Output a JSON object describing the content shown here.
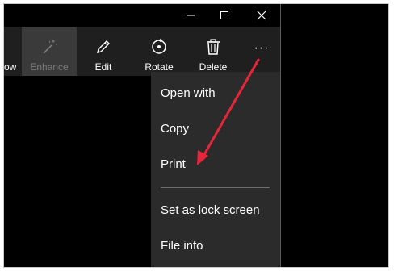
{
  "window_controls": {
    "minimize_icon": "minimize-icon",
    "maximize_icon": "maximize-icon",
    "close_icon": "close-icon"
  },
  "toolbar": {
    "partial_label": "ow",
    "enhance_label": "Enhance",
    "edit_label": "Edit",
    "rotate_label": "Rotate",
    "delete_label": "Delete",
    "more_label": "···"
  },
  "menu": {
    "items": [
      "Open with",
      "Copy",
      "Print",
      "Set as lock screen",
      "File info"
    ]
  },
  "colors": {
    "toolbar_bg": "#1f1f1f",
    "menu_bg": "#2b2b2b",
    "arrow": "#e8263b"
  }
}
